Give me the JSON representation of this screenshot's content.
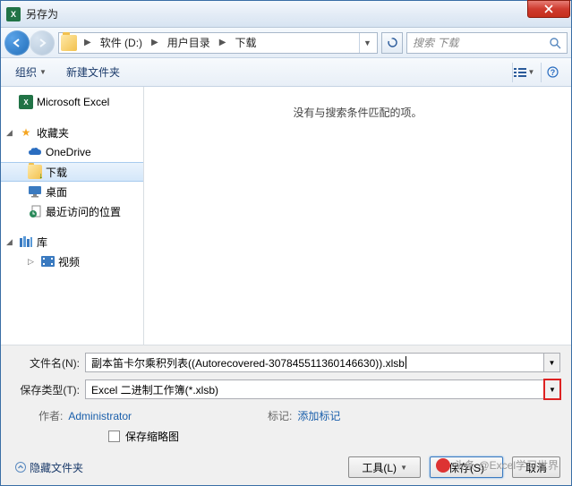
{
  "title": "另存为",
  "breadcrumb": {
    "seg1": "软件 (D:)",
    "seg2": "用户目录",
    "seg3": "下载"
  },
  "search": {
    "placeholder": "搜索 下载"
  },
  "toolbar": {
    "organize": "组织",
    "newfolder": "新建文件夹"
  },
  "tree": {
    "excel": "Microsoft Excel",
    "favorites": "收藏夹",
    "onedrive": "OneDrive",
    "downloads": "下载",
    "desktop": "桌面",
    "recent": "最近访问的位置",
    "libraries": "库",
    "video": "视频"
  },
  "filelist": {
    "empty": "没有与搜索条件匹配的项。"
  },
  "fields": {
    "filename_label": "文件名(N):",
    "filename_value": "副本笛卡尔乘积列表((Autorecovered-307845511360146630)).xlsb",
    "filetype_label": "保存类型(T):",
    "filetype_value": "Excel 二进制工作簿(*.xlsb)"
  },
  "meta": {
    "author_label": "作者:",
    "author_value": "Administrator",
    "tags_label": "标记:",
    "tags_value": "添加标记"
  },
  "checkbox": {
    "thumbnail": "保存缩略图"
  },
  "buttons": {
    "hide_folders": "隐藏文件夹",
    "tools": "工具(L)",
    "save": "保存(S)",
    "cancel": "取消"
  },
  "watermark": "头条 @Excel学习世界"
}
